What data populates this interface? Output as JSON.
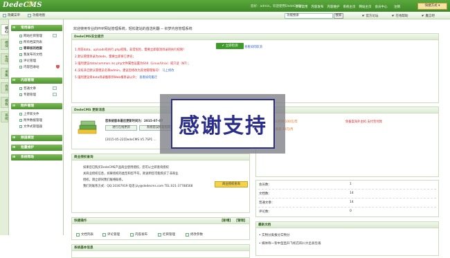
{
  "brand": {
    "logo": "DedeCMS",
    "version_tag": "DEV",
    "version": "V5.7"
  },
  "top": {
    "welcome": "您好：admin，欢迎使用DedeCMS！",
    "tabs": [
      "文章常用",
      "内容发布",
      "内容维护",
      "系统主页",
      "网站主页",
      "会员中心",
      "注销"
    ],
    "quick_menu": "快捷方式"
  },
  "subbar": {
    "hide_menu": "隐藏菜单",
    "function_map": "功能地图",
    "search_placeholder": "功能搜索",
    "search_button": "搜索",
    "official_forum": "官方论坛",
    "online_help": "在线帮助",
    "magic_bg": "魔言吧"
  },
  "left_tabs": [
    "核心",
    "模块",
    "生成",
    "采集",
    "会员",
    "模板",
    "系统"
  ],
  "sidebar": {
    "sections": [
      {
        "title": "常用操作",
        "items": [
          "网站栏目管理",
          "所有档案列表",
          "等审核的档案",
          "我发布的文档",
          "评论管理",
          "内容回收站"
        ]
      },
      {
        "title": "内容管理",
        "items": [
          "普通文章",
          "专题管理"
        ]
      },
      {
        "title": "附件管理",
        "items": [
          "上传新文件",
          "附件数据管理",
          "文件式管理器"
        ]
      },
      {
        "title": "频道模型"
      },
      {
        "title": "批量维护"
      },
      {
        "title": "系统帮助"
      }
    ]
  },
  "main": {
    "greeting": "欢迎使用专业的PHP网站管理系统，轻松建站的首选利器 -- 织梦内容管理系统",
    "security": {
      "title": "DedeCMS安全提示",
      "lines": [
        "1.目前data、uploads有执行.php权限，非常危险，需要立即取消目录的执行权限！",
        "2.默认管理目录为dede，需要立即将它更名；",
        "3.强烈建议data/common.inc.php文件属性设置为644（Linux/Unix）或只读（NT）；",
        "4.没有开启默认管理员名称admin，建议您修改为其他管理账号！",
        "5.强烈建议将data目录搬移到Web根目录以外；"
      ],
      "line4_link": "马上修改",
      "line5_link": "查看如何搬迁",
      "check_button": "立即检测",
      "check_link": "查看如何取消"
    },
    "update": {
      "title": "DedeCMS 更新消息",
      "line1": "您系统版本最后更新时间为：2015-07-07",
      "btn1": "进行在线更新",
      "btn2": "系统错误修复指南",
      "log": "[2015-05-22]DedeCMS V5.7SP1 ..."
    },
    "license": {
      "title": "商业授权查询",
      "lines": [
        "如果您已购买DedeCMS产品商业使用授权，您可以立即查询授权",
        "关商业授权信息，如果授权的类型和您不符，则说明您可能购买了非商业",
        "授权，请立即同我们联络联系。",
        "我们的联系方式：QQ:10307919 电话:jzy@dedecms.com TEL:021-37788568"
      ],
      "query_button": "商业授权查询"
    },
    "quick": {
      "title": "快捷操作",
      "add": "【新增】",
      "manage": "【管理】",
      "links": [
        "文档列表",
        "评论管理",
        "内容发布",
        "栏目管理",
        "修改参数"
      ]
    },
    "sysinfo": {
      "title": "系统基本信息"
    },
    "right_top": {
      "title": "赞助商链接",
      "rows": [
        {
          "col1": "2016-05：10空间 100元/年",
          "col2": "免备案海外主机 支付宝付款"
        },
        {
          "col1": "400元/年 免备案 30元/月",
          "col2": ""
        }
      ]
    },
    "stats": {
      "rows": [
        {
          "label": "会员数：",
          "value": "1"
        },
        {
          "label": "文档数：",
          "value": "14"
        },
        {
          "label": "普通文章：",
          "value": "14"
        },
        {
          "label": "评论数：",
          "value": "0"
        }
      ]
    },
    "latest": {
      "title": "最新文档",
      "items": [
        "实物分类报分实物分",
        "媒体称一架中型直升飞机在四川大邑县坠毁"
      ]
    }
  },
  "overlay": {
    "text": "感谢支持"
  },
  "colors": {
    "accent": "#4f9333",
    "warning": "#d22222",
    "overlay_border": "#2a2d8a"
  }
}
